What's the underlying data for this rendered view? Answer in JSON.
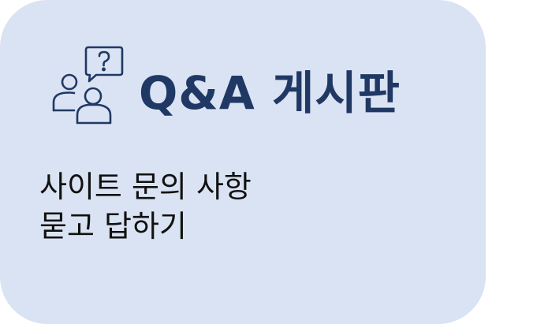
{
  "card": {
    "icon": "qa-discussion-icon",
    "title": "Q&A 게시판",
    "description_line1": "사이트 문의 사항",
    "description_line2": "묻고 답하기",
    "background_color": "#dae3f3",
    "title_color": "#203864"
  }
}
